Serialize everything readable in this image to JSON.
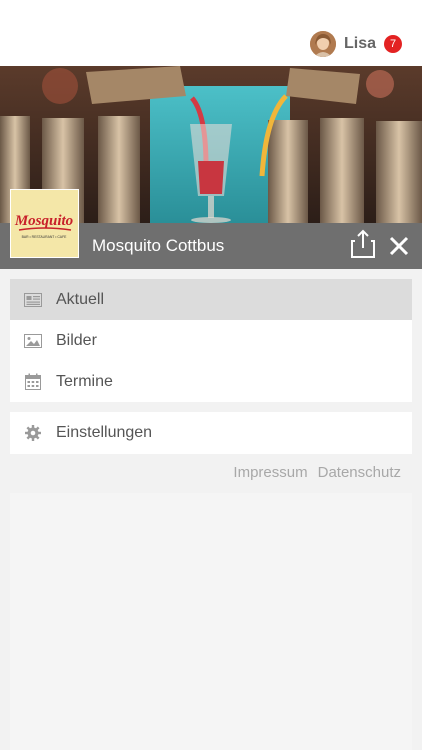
{
  "header": {
    "user_name": "Lisa",
    "notification_count": "7"
  },
  "venue": {
    "name": "Mosquito Cottbus",
    "logo_text": "Mosquito",
    "logo_subtext": "BAR • RESTAURANT • CAFE"
  },
  "menu": {
    "items": [
      {
        "label": "Aktuell",
        "icon": "newspaper-icon",
        "active": true
      },
      {
        "label": "Bilder",
        "icon": "image-icon",
        "active": false
      },
      {
        "label": "Termine",
        "icon": "calendar-icon",
        "active": false
      }
    ],
    "settings_label": "Einstellungen",
    "settings_icon": "gear-icon"
  },
  "footer": {
    "impressum": "Impressum",
    "datenschutz": "Datenschutz"
  },
  "colors": {
    "badge": "#e32222",
    "venue_bar": "#6f6f6f",
    "active_item": "#dcdcdc"
  }
}
